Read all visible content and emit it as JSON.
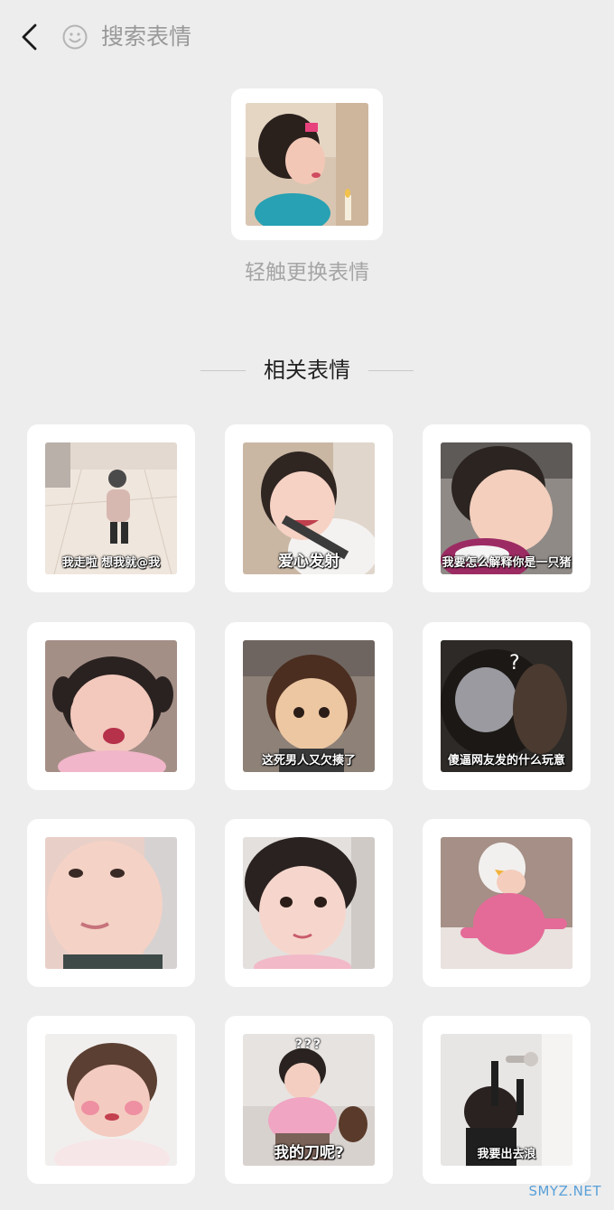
{
  "header": {
    "search_placeholder": "搜索表情"
  },
  "main": {
    "hint": "轻触更换表情",
    "section_title": "相关表情"
  },
  "stickers": [
    {
      "caption": "我走啦 想我就@我"
    },
    {
      "caption": "爱心发射"
    },
    {
      "caption": "我要怎么解释你是一只猪"
    },
    {
      "caption": ""
    },
    {
      "caption": "这死男人又欠揍了"
    },
    {
      "caption": "傻逼网友发的什么玩意"
    },
    {
      "caption": ""
    },
    {
      "caption": ""
    },
    {
      "caption": ""
    },
    {
      "caption": ""
    },
    {
      "caption": "我的刀呢?",
      "top_text": "???"
    },
    {
      "caption": "我要出去浪"
    }
  ],
  "watermark": "SMYZ.NET",
  "colors": {
    "background": "#ededed",
    "card": "#ffffff",
    "muted_text": "#999999",
    "title_text": "#222222"
  }
}
